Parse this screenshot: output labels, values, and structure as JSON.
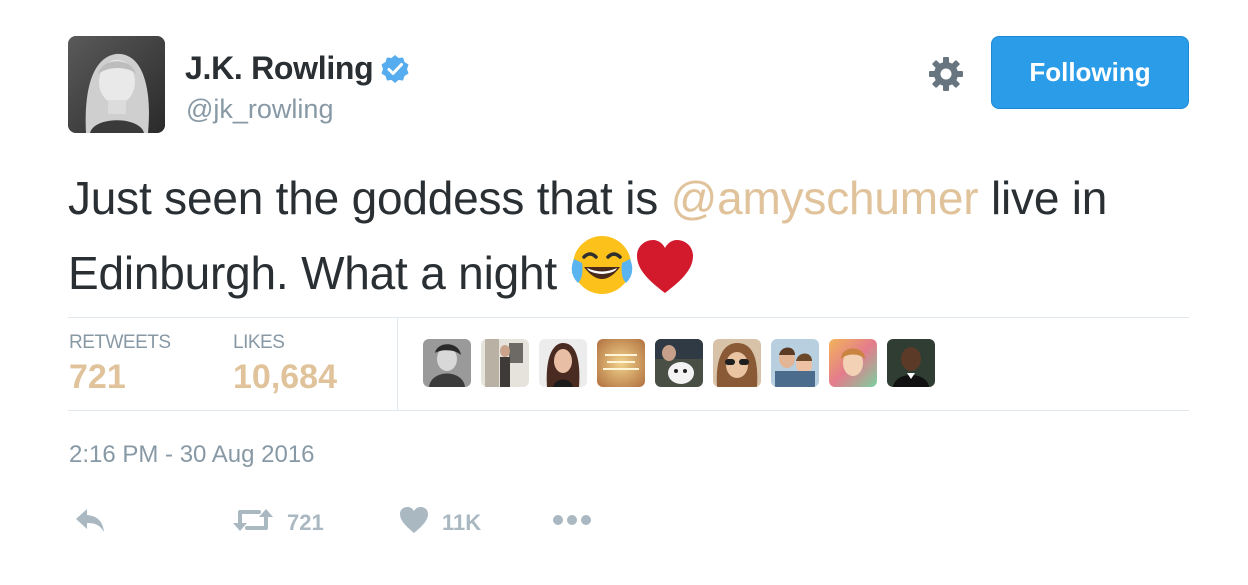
{
  "author": {
    "display_name": "J.K. Rowling",
    "handle": "@jk_rowling",
    "verified": true
  },
  "follow_button": {
    "label": "Following"
  },
  "tweet": {
    "text_before": "Just seen the goddess that is ",
    "mention": "@amyschumer",
    "text_after": " live in Edinburgh. What a night ",
    "emojis": [
      "face-with-tears-of-joy",
      "red-heart"
    ]
  },
  "stats": {
    "retweets_label": "RETWEETS",
    "retweets_value": "721",
    "likes_label": "LIKES",
    "likes_value": "10,684"
  },
  "likers_count_shown": 9,
  "timestamp": "2:16 PM - 30 Aug 2016",
  "actions": {
    "reply_icon": "reply-icon",
    "retweet_count": "721",
    "like_count": "11K",
    "more_icon": "more-icon"
  },
  "colors": {
    "accent_blue": "#2b9ce8",
    "mention_tan": "#e0c39b",
    "muted_gray": "#8899a6",
    "action_gray": "#aab8c2",
    "divider": "#e1e8ed"
  }
}
